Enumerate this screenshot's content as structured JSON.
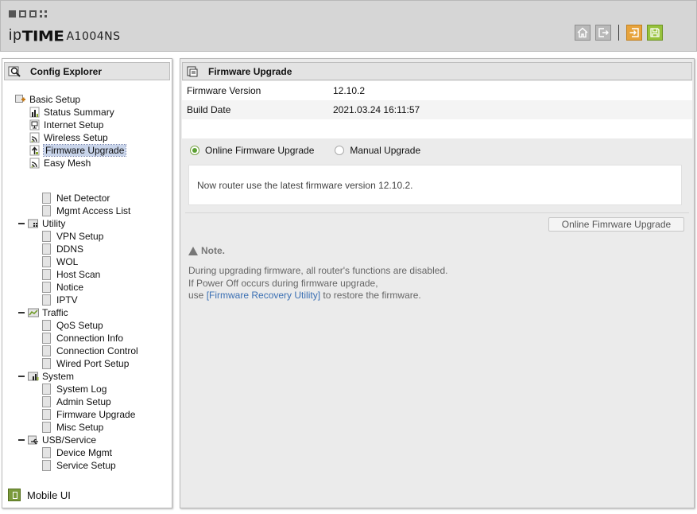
{
  "header": {
    "logo_ip": "ip",
    "logo_time": "TIME",
    "model": "A1004NS",
    "icons": [
      "home-icon",
      "logout-icon",
      "save-config-icon",
      "apply-save-icon"
    ]
  },
  "sidebar": {
    "title": "Config Explorer",
    "basic_setup": {
      "label": "Basic Setup",
      "items": [
        "Status Summary",
        "Internet Setup",
        "Wireless Setup",
        "Firmware Upgrade",
        "Easy Mesh"
      ],
      "selected": "Firmware Upgrade"
    },
    "misc_items": [
      "Net Detector",
      "Mgmt Access List"
    ],
    "groups": [
      {
        "label": "Utility",
        "items": [
          "VPN Setup",
          "DDNS",
          "WOL",
          "Host Scan",
          "Notice",
          "IPTV"
        ]
      },
      {
        "label": "Traffic",
        "items": [
          "QoS Setup",
          "Connection Info",
          "Connection Control",
          "Wired Port Setup"
        ]
      },
      {
        "label": "System",
        "items": [
          "System Log",
          "Admin Setup",
          "Firmware Upgrade",
          "Misc Setup"
        ]
      },
      {
        "label": "USB/Service",
        "items": [
          "Device Mgmt",
          "Service Setup"
        ]
      }
    ],
    "mobile_ui": "Mobile UI"
  },
  "main": {
    "title": "Firmware Upgrade",
    "info": [
      {
        "key": "Firmware Version",
        "value": "12.10.2"
      },
      {
        "key": "Build Date",
        "value": "2021.03.24 16:11:57"
      }
    ],
    "radio_online": "Online Firmware Upgrade",
    "radio_manual": "Manual Upgrade",
    "selected_mode": "Online Firmware Upgrade",
    "message": "Now router use the latest firmware version 12.10.2.",
    "upgrade_button": "Online Fimrware Upgrade",
    "note": {
      "title": "Note.",
      "line1": "During upgrading firmware, all router's functions are disabled.",
      "line2": "If Power Off occurs during firmware upgrade,",
      "line3_pre": "use ",
      "line3_link": "[Firmware Recovery Utility]",
      "line3_post": " to restore the firmware."
    }
  }
}
